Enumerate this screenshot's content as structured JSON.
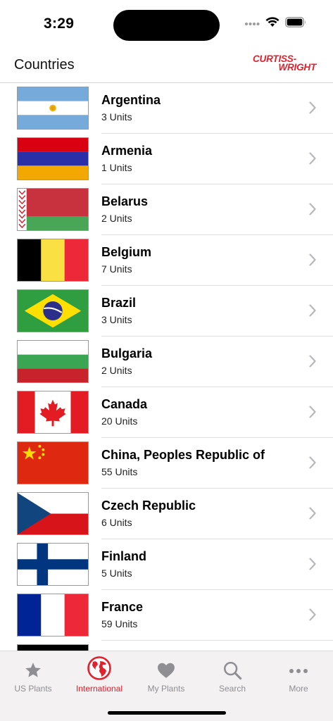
{
  "status": {
    "time": "3:29"
  },
  "header": {
    "title": "Countries",
    "logo_line1": "CURTISS-",
    "logo_line2": "WRIGHT",
    "accent": "#e2202e"
  },
  "countries": [
    {
      "name": "Argentina",
      "units": "3 Units",
      "flag": "argentina"
    },
    {
      "name": "Armenia",
      "units": "1 Units",
      "flag": "armenia"
    },
    {
      "name": "Belarus",
      "units": "2 Units",
      "flag": "belarus"
    },
    {
      "name": "Belgium",
      "units": "7 Units",
      "flag": "belgium"
    },
    {
      "name": "Brazil",
      "units": "3 Units",
      "flag": "brazil"
    },
    {
      "name": "Bulgaria",
      "units": "2 Units",
      "flag": "bulgaria"
    },
    {
      "name": "Canada",
      "units": "20 Units",
      "flag": "canada"
    },
    {
      "name": "China, Peoples Republic of",
      "units": "55 Units",
      "flag": "china"
    },
    {
      "name": "Czech Republic",
      "units": "6 Units",
      "flag": "czech"
    },
    {
      "name": "Finland",
      "units": "5 Units",
      "flag": "finland"
    },
    {
      "name": "France",
      "units": "59 Units",
      "flag": "france"
    },
    {
      "name": "",
      "units": "",
      "flag": "partial"
    }
  ],
  "tabs": [
    {
      "label": "US Plants",
      "icon": "star-icon",
      "active": false
    },
    {
      "label": "International",
      "icon": "globe-icon",
      "active": true
    },
    {
      "label": "My Plants",
      "icon": "heart-icon",
      "active": false
    },
    {
      "label": "Search",
      "icon": "search-icon",
      "active": false
    },
    {
      "label": "More",
      "icon": "more-icon",
      "active": false
    }
  ]
}
